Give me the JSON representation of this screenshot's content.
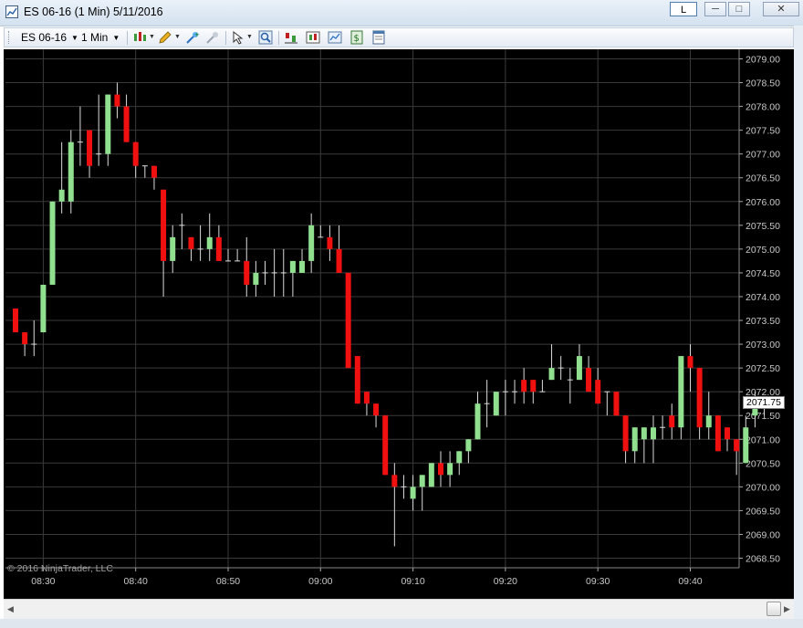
{
  "window": {
    "title": "ES 06-16 (1 Min)  5/11/2016",
    "link_label": "L"
  },
  "toolbar": {
    "instrument": "ES 06-16",
    "interval": "1 Min",
    "icons": [
      "bar-type-icon",
      "drawing-pencil-icon",
      "insert-icon",
      "remove-icon",
      "cursor-icon",
      "zoom-icon",
      "strategies-icon",
      "indicators-icon",
      "chart-properties-icon",
      "dollar-icon",
      "data-box-icon"
    ]
  },
  "chart": {
    "copyright": "© 2016 NinjaTrader, LLC",
    "last_price_label": "2071.75",
    "colors": {
      "up": "#90e090",
      "down": "#f01010",
      "background": "#000000",
      "grid": "#3a3a3a",
      "price_tag": "#ffffff"
    }
  },
  "chart_data": {
    "type": "candlestick",
    "ylim": [
      2068.25,
      2079.0
    ],
    "y_ticks": [
      "2079.00",
      "2078.50",
      "2078.00",
      "2077.50",
      "2077.00",
      "2076.50",
      "2076.00",
      "2075.50",
      "2075.00",
      "2074.50",
      "2074.00",
      "2073.50",
      "2073.00",
      "2072.50",
      "2072.00",
      "2071.50",
      "2071.00",
      "2070.50",
      "2070.00",
      "2069.50",
      "2069.00",
      "2068.50"
    ],
    "x_ticks": [
      "08:30",
      "08:40",
      "08:50",
      "09:00",
      "09:10",
      "09:20",
      "09:30",
      "09:40"
    ],
    "bars": [
      {
        "o": 2073.75,
        "h": 2073.75,
        "l": 2073.25,
        "c": 2073.25
      },
      {
        "o": 2073.25,
        "h": 2073.25,
        "l": 2072.75,
        "c": 2073.0
      },
      {
        "o": 2073.0,
        "h": 2073.5,
        "l": 2072.75,
        "c": 2073.0
      },
      {
        "o": 2073.25,
        "h": 2074.25,
        "l": 2073.25,
        "c": 2074.25
      },
      {
        "o": 2074.25,
        "h": 2076.0,
        "l": 2074.25,
        "c": 2076.0
      },
      {
        "o": 2076.0,
        "h": 2077.25,
        "l": 2075.75,
        "c": 2076.25
      },
      {
        "o": 2076.0,
        "h": 2077.5,
        "l": 2075.75,
        "c": 2077.25
      },
      {
        "o": 2077.25,
        "h": 2078.0,
        "l": 2076.75,
        "c": 2077.25
      },
      {
        "o": 2077.5,
        "h": 2077.5,
        "l": 2076.5,
        "c": 2076.75
      },
      {
        "o": 2077.0,
        "h": 2078.25,
        "l": 2076.75,
        "c": 2077.0
      },
      {
        "o": 2077.0,
        "h": 2078.25,
        "l": 2076.75,
        "c": 2078.25
      },
      {
        "o": 2078.25,
        "h": 2078.5,
        "l": 2077.75,
        "c": 2078.0
      },
      {
        "o": 2078.0,
        "h": 2078.25,
        "l": 2077.25,
        "c": 2077.25
      },
      {
        "o": 2077.25,
        "h": 2077.25,
        "l": 2076.5,
        "c": 2076.75
      },
      {
        "o": 2076.75,
        "h": 2076.75,
        "l": 2076.5,
        "c": 2076.75
      },
      {
        "o": 2076.75,
        "h": 2076.75,
        "l": 2076.25,
        "c": 2076.5
      },
      {
        "o": 2076.25,
        "h": 2076.25,
        "l": 2074.0,
        "c": 2074.75
      },
      {
        "o": 2074.75,
        "h": 2075.5,
        "l": 2074.5,
        "c": 2075.25
      },
      {
        "o": 2075.5,
        "h": 2075.75,
        "l": 2075.0,
        "c": 2075.5
      },
      {
        "o": 2075.25,
        "h": 2075.25,
        "l": 2074.75,
        "c": 2075.0
      },
      {
        "o": 2075.0,
        "h": 2075.5,
        "l": 2074.75,
        "c": 2075.0
      },
      {
        "o": 2075.0,
        "h": 2075.75,
        "l": 2074.75,
        "c": 2075.25
      },
      {
        "o": 2075.25,
        "h": 2075.5,
        "l": 2074.75,
        "c": 2074.75
      },
      {
        "o": 2074.75,
        "h": 2075.0,
        "l": 2074.75,
        "c": 2074.75
      },
      {
        "o": 2074.75,
        "h": 2075.0,
        "l": 2074.75,
        "c": 2074.75
      },
      {
        "o": 2074.75,
        "h": 2075.25,
        "l": 2074.0,
        "c": 2074.25
      },
      {
        "o": 2074.25,
        "h": 2074.75,
        "l": 2074.0,
        "c": 2074.5
      },
      {
        "o": 2074.5,
        "h": 2074.75,
        "l": 2074.25,
        "c": 2074.5
      },
      {
        "o": 2074.5,
        "h": 2075.0,
        "l": 2074.0,
        "c": 2074.5
      },
      {
        "o": 2074.5,
        "h": 2075.0,
        "l": 2074.0,
        "c": 2074.5
      },
      {
        "o": 2074.5,
        "h": 2074.75,
        "l": 2074.0,
        "c": 2074.75
      },
      {
        "o": 2074.5,
        "h": 2075.0,
        "l": 2074.5,
        "c": 2074.75
      },
      {
        "o": 2074.75,
        "h": 2075.75,
        "l": 2074.5,
        "c": 2075.5
      },
      {
        "o": 2075.25,
        "h": 2075.5,
        "l": 2075.25,
        "c": 2075.25
      },
      {
        "o": 2075.25,
        "h": 2075.5,
        "l": 2074.75,
        "c": 2075.0
      },
      {
        "o": 2075.0,
        "h": 2075.5,
        "l": 2074.5,
        "c": 2074.5
      },
      {
        "o": 2074.5,
        "h": 2074.5,
        "l": 2072.5,
        "c": 2072.5
      },
      {
        "o": 2072.75,
        "h": 2072.75,
        "l": 2071.75,
        "c": 2071.75
      },
      {
        "o": 2072.0,
        "h": 2072.0,
        "l": 2071.5,
        "c": 2071.75
      },
      {
        "o": 2071.75,
        "h": 2071.75,
        "l": 2071.25,
        "c": 2071.5
      },
      {
        "o": 2071.5,
        "h": 2071.5,
        "l": 2070.25,
        "c": 2070.25
      },
      {
        "o": 2070.25,
        "h": 2070.5,
        "l": 2068.75,
        "c": 2070.0
      },
      {
        "o": 2070.0,
        "h": 2070.25,
        "l": 2069.75,
        "c": 2070.0
      },
      {
        "o": 2069.75,
        "h": 2070.25,
        "l": 2069.5,
        "c": 2070.0
      },
      {
        "o": 2070.0,
        "h": 2070.25,
        "l": 2069.5,
        "c": 2070.25
      },
      {
        "o": 2070.0,
        "h": 2070.5,
        "l": 2070.0,
        "c": 2070.5
      },
      {
        "o": 2070.5,
        "h": 2070.75,
        "l": 2070.0,
        "c": 2070.25
      },
      {
        "o": 2070.25,
        "h": 2070.75,
        "l": 2070.0,
        "c": 2070.5
      },
      {
        "o": 2070.5,
        "h": 2070.75,
        "l": 2070.25,
        "c": 2070.75
      },
      {
        "o": 2070.75,
        "h": 2071.0,
        "l": 2070.5,
        "c": 2071.0
      },
      {
        "o": 2071.0,
        "h": 2072.0,
        "l": 2071.0,
        "c": 2071.75
      },
      {
        "o": 2071.75,
        "h": 2072.25,
        "l": 2071.25,
        "c": 2071.75
      },
      {
        "o": 2071.5,
        "h": 2072.0,
        "l": 2071.5,
        "c": 2072.0
      },
      {
        "o": 2072.0,
        "h": 2072.25,
        "l": 2071.5,
        "c": 2072.0
      },
      {
        "o": 2072.0,
        "h": 2072.25,
        "l": 2071.75,
        "c": 2072.0
      },
      {
        "o": 2072.25,
        "h": 2072.5,
        "l": 2071.75,
        "c": 2072.0
      },
      {
        "o": 2072.25,
        "h": 2072.25,
        "l": 2071.75,
        "c": 2072.0
      },
      {
        "o": 2072.0,
        "h": 2072.25,
        "l": 2072.0,
        "c": 2072.0
      },
      {
        "o": 2072.25,
        "h": 2073.0,
        "l": 2072.25,
        "c": 2072.5
      },
      {
        "o": 2072.5,
        "h": 2072.75,
        "l": 2072.25,
        "c": 2072.5
      },
      {
        "o": 2072.25,
        "h": 2072.5,
        "l": 2071.75,
        "c": 2072.25
      },
      {
        "o": 2072.25,
        "h": 2073.0,
        "l": 2072.25,
        "c": 2072.75
      },
      {
        "o": 2072.5,
        "h": 2072.75,
        "l": 2072.0,
        "c": 2072.0
      },
      {
        "o": 2072.25,
        "h": 2072.5,
        "l": 2071.75,
        "c": 2071.75
      },
      {
        "o": 2072.0,
        "h": 2072.0,
        "l": 2071.5,
        "c": 2072.0
      },
      {
        "o": 2072.0,
        "h": 2072.0,
        "l": 2071.5,
        "c": 2071.5
      },
      {
        "o": 2071.5,
        "h": 2071.5,
        "l": 2070.5,
        "c": 2070.75
      },
      {
        "o": 2070.75,
        "h": 2071.25,
        "l": 2070.5,
        "c": 2071.25
      },
      {
        "o": 2071.0,
        "h": 2071.25,
        "l": 2070.5,
        "c": 2071.25
      },
      {
        "o": 2071.0,
        "h": 2071.5,
        "l": 2070.5,
        "c": 2071.25
      },
      {
        "o": 2071.25,
        "h": 2071.5,
        "l": 2071.0,
        "c": 2071.25
      },
      {
        "o": 2071.5,
        "h": 2071.75,
        "l": 2071.0,
        "c": 2071.25
      },
      {
        "o": 2071.25,
        "h": 2072.75,
        "l": 2071.0,
        "c": 2072.75
      },
      {
        "o": 2072.75,
        "h": 2073.0,
        "l": 2072.0,
        "c": 2072.5
      },
      {
        "o": 2072.5,
        "h": 2072.5,
        "l": 2071.0,
        "c": 2071.25
      },
      {
        "o": 2071.25,
        "h": 2072.0,
        "l": 2071.0,
        "c": 2071.5
      },
      {
        "o": 2071.5,
        "h": 2071.5,
        "l": 2070.75,
        "c": 2070.75
      },
      {
        "o": 2071.25,
        "h": 2071.25,
        "l": 2070.75,
        "c": 2071.0
      },
      {
        "o": 2071.0,
        "h": 2071.0,
        "l": 2070.25,
        "c": 2070.75
      },
      {
        "o": 2070.5,
        "h": 2071.5,
        "l": 2070.5,
        "c": 2071.25
      },
      {
        "o": 2071.5,
        "h": 2072.0,
        "l": 2071.25,
        "c": 2071.75
      },
      {
        "o": 2071.75,
        "h": 2071.75,
        "l": 2071.5,
        "c": 2071.75
      }
    ]
  }
}
